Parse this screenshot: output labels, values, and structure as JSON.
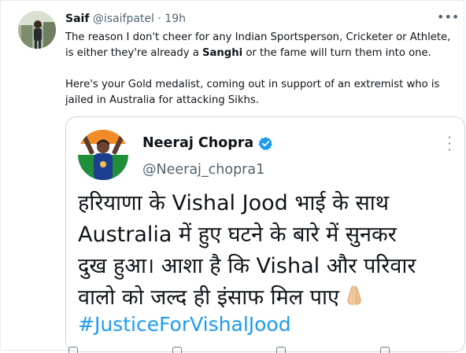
{
  "tweet": {
    "author_name": "Saif",
    "author_handle": "@isaifpatel",
    "separator": "·",
    "time": "19h",
    "more_icon": "more-horizontal-icon",
    "text_line1_before": "The reason I don't cheer for any Indian Sportsperson, Cricketer or Athlete,",
    "text_line2_before": "is either they're already a ",
    "text_line2_bold": "Sanghi",
    "text_line2_after": " or the fame will turn them into one.",
    "text_para2_line1": "Here's your Gold medalist, coming out in support of an extremist who is",
    "text_para2_line2": "jailed in Australia for attacking Sikhs."
  },
  "quote": {
    "author_name": "Neeraj Chopra",
    "author_handle": "@Neeraj_chopra1",
    "verified_icon": "verified-badge-icon",
    "more_icon": "more-vertical-icon",
    "lines": [
      "हरियाणा के Vishal Jood भाई के साथ",
      "Australia में हुए घटने के बारे में सुनकर",
      "दुख हुआ। आशा है कि Vishal और परिवार",
      "वालो को जल्द ही इंसाफ मिल पाए"
    ],
    "emoji_icon": "folded-hands-icon",
    "hashtag": "#JusticeForVishalJood"
  },
  "colors": {
    "text": "#0f1419",
    "muted": "#536471",
    "link": "#1d9bf0",
    "border": "#cfd9de"
  }
}
